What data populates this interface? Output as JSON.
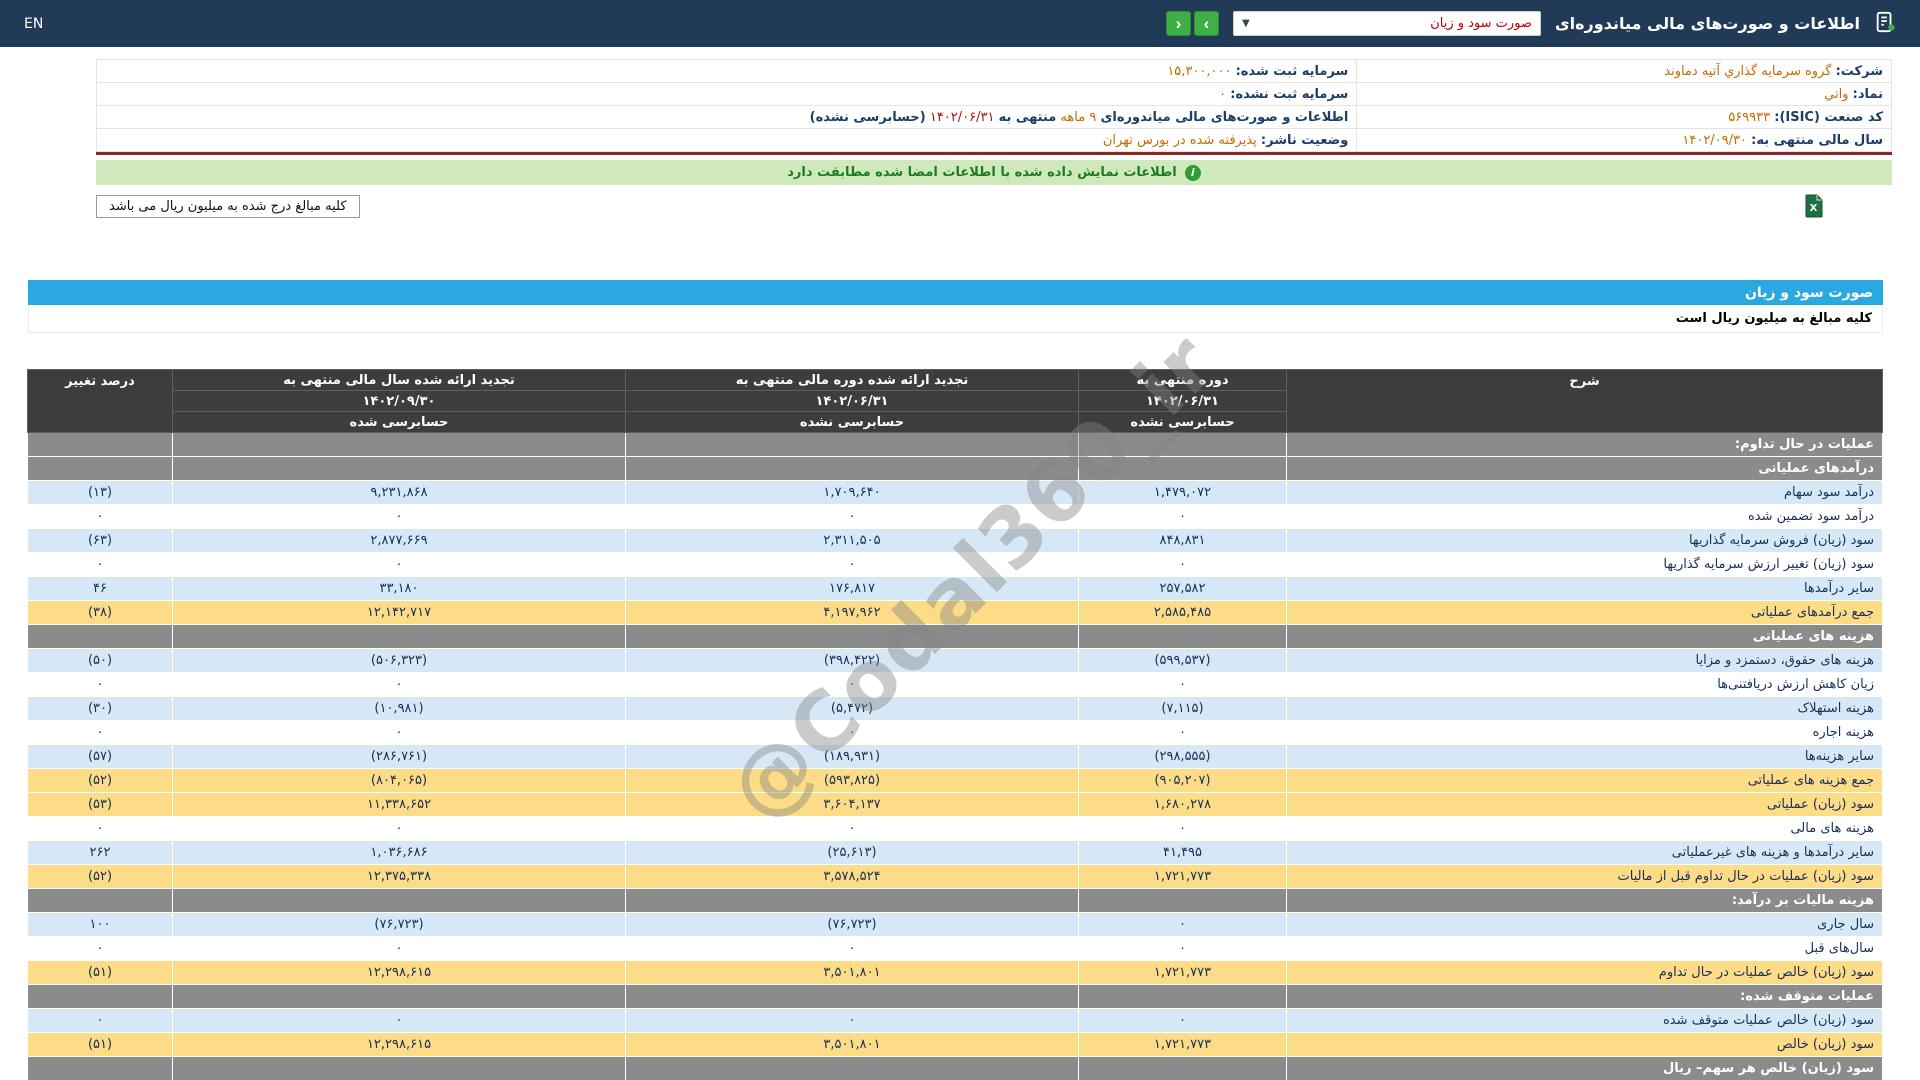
{
  "topbar": {
    "language": "EN",
    "title": "اطلاعات و صورت‌های مالی میاندوره‌ای",
    "report_dropdown": {
      "selected": "صورت سود و زیان",
      "caret": "▼"
    },
    "nav": {
      "right_arrow": "›",
      "left_arrow": "‹"
    }
  },
  "company_info": {
    "rows": [
      {
        "right_label": "شرکت:",
        "right_value": "گروه سرمایه گذاري آتیه دماوند",
        "left_label": "سرمایه ثبت شده:",
        "left_value": "۱۵,۳۰۰,۰۰۰"
      },
      {
        "right_label": "نماد:",
        "right_value": "واتي",
        "left_label": "سرمایه ثبت نشده:",
        "left_value": "۰"
      },
      {
        "right_label": "کد صنعت (ISIC):",
        "right_value": "۵۶۹۹۳۳",
        "left_prefix": "اطلاعات و صورت‌های مالی میاندوره‌ای",
        "left_period": "۹ ماهه",
        "left_middle": "منتهی به",
        "left_date": "۱۴۰۲/۰۶/۳۱",
        "left_suffix": "(حسابرسی نشده)"
      },
      {
        "right_label": "سال مالی منتهی به:",
        "right_value": "۱۴۰۲/۰۹/۳۰",
        "left_label": "وضعیت ناشر:",
        "left_value": "پذیرفته شده در بورس تهران"
      }
    ]
  },
  "banner": {
    "text": "اطلاعات نمایش داده شده با اطلاعات امضا شده مطابقت دارد",
    "icon": "i"
  },
  "note": {
    "text": "کلیه مبالغ درج شده به میلیون ریال می باشد"
  },
  "statement": {
    "title": "صورت سود و زیان",
    "subtitle": "کلیه مبالغ به میلیون ریال است"
  },
  "table": {
    "header": {
      "description": "شرح",
      "change": "درصد تغییر",
      "col1": {
        "title": "دوره منتهی به",
        "date": "۱۴۰۲/۰۶/۳۱",
        "audit": "حسابرسی نشده"
      },
      "col2": {
        "title": "تجدید ارائه شده دوره مالی منتهی به",
        "date": "۱۴۰۲/۰۶/۳۱",
        "audit": "حسابرسی نشده"
      },
      "col3": {
        "title": "تجدید ارائه شده سال مالی منتهی به",
        "date": "۱۴۰۲/۰۹/۳۰",
        "audit": "حسابرسی شده"
      }
    },
    "rows": [
      {
        "type": "section",
        "label": "عملیات در حال تداوم:"
      },
      {
        "type": "section",
        "label": "درآمدهای عملیاتی"
      },
      {
        "type": "data",
        "variant": "blue",
        "label": "درآمد سود سهام",
        "v1": "۱,۴۷۹,۰۷۲",
        "v2": "۱,۷۰۹,۶۴۰",
        "v3": "۹,۲۳۱,۸۶۸",
        "chg": "(۱۳)",
        "neg": [
          false,
          false,
          false,
          true
        ]
      },
      {
        "type": "data",
        "variant": "white",
        "label": "درآمد سود تضمین شده",
        "v1": "۰",
        "v2": "۰",
        "v3": "۰",
        "chg": "۰",
        "neg": [
          false,
          false,
          false,
          false
        ]
      },
      {
        "type": "data",
        "variant": "blue",
        "label": "سود (زیان) فروش سرمایه گذاریها",
        "v1": "۸۴۸,۸۳۱",
        "v2": "۲,۳۱۱,۵۰۵",
        "v3": "۲,۸۷۷,۶۶۹",
        "chg": "(۶۳)",
        "neg": [
          false,
          false,
          false,
          true
        ]
      },
      {
        "type": "data",
        "variant": "white",
        "label": "سود (زیان) تغییر ارزش سرمایه گذاریها",
        "v1": "۰",
        "v2": "۰",
        "v3": "۰",
        "chg": "۰",
        "neg": [
          false,
          false,
          false,
          false
        ]
      },
      {
        "type": "data",
        "variant": "blue",
        "label": "سایر درآمدها",
        "v1": "۲۵۷,۵۸۲",
        "v2": "۱۷۶,۸۱۷",
        "v3": "۳۳,۱۸۰",
        "chg": "۴۶",
        "neg": [
          false,
          false,
          false,
          false
        ]
      },
      {
        "type": "data",
        "variant": "yellow",
        "label": "جمع درآمدهای عملیاتی",
        "v1": "۲,۵۸۵,۴۸۵",
        "v2": "۴,۱۹۷,۹۶۲",
        "v3": "۱۲,۱۴۲,۷۱۷",
        "chg": "(۳۸)",
        "neg": [
          false,
          false,
          false,
          true
        ]
      },
      {
        "type": "section",
        "label": "هزینه های عملیاتی"
      },
      {
        "type": "data",
        "variant": "blue",
        "label": "هزینه های حقوق، دستمزد و مزایا",
        "v1": "(۵۹۹,۵۳۷)",
        "v2": "(۳۹۸,۴۲۲)",
        "v3": "(۵۰۶,۳۲۳)",
        "chg": "(۵۰)",
        "neg": [
          true,
          true,
          true,
          true
        ]
      },
      {
        "type": "data",
        "variant": "white",
        "label": "زیان کاهش ارزش دریافتنی‌ها",
        "v1": "۰",
        "v2": "۰",
        "v3": "۰",
        "chg": "۰",
        "neg": [
          false,
          false,
          false,
          false
        ]
      },
      {
        "type": "data",
        "variant": "blue",
        "label": "هزینه استهلاک",
        "v1": "(۷,۱۱۵)",
        "v2": "(۵,۴۷۲)",
        "v3": "(۱۰,۹۸۱)",
        "chg": "(۳۰)",
        "neg": [
          true,
          true,
          true,
          true
        ]
      },
      {
        "type": "data",
        "variant": "white",
        "label": "هزینه اجاره",
        "v1": "۰",
        "v2": "۰",
        "v3": "۰",
        "chg": "۰",
        "neg": [
          false,
          false,
          false,
          false
        ]
      },
      {
        "type": "data",
        "variant": "blue",
        "label": "سایر هزینه‌ها",
        "v1": "(۲۹۸,۵۵۵)",
        "v2": "(۱۸۹,۹۳۱)",
        "v3": "(۲۸۶,۷۶۱)",
        "chg": "(۵۷)",
        "neg": [
          true,
          true,
          true,
          true
        ]
      },
      {
        "type": "data",
        "variant": "yellow",
        "label": "جمع هزینه های عملیاتی",
        "v1": "(۹۰۵,۲۰۷)",
        "v2": "(۵۹۳,۸۲۵)",
        "v3": "(۸۰۴,۰۶۵)",
        "chg": "(۵۲)",
        "neg": [
          true,
          true,
          true,
          true
        ]
      },
      {
        "type": "data",
        "variant": "yellow",
        "label": "سود (زیان) عملیاتی",
        "v1": "۱,۶۸۰,۲۷۸",
        "v2": "۳,۶۰۴,۱۳۷",
        "v3": "۱۱,۳۳۸,۶۵۲",
        "chg": "(۵۳)",
        "neg": [
          false,
          false,
          false,
          true
        ]
      },
      {
        "type": "data",
        "variant": "white",
        "label": "هزینه های مالی",
        "v1": "۰",
        "v2": "۰",
        "v3": "۰",
        "chg": "۰",
        "neg": [
          false,
          false,
          false,
          false
        ]
      },
      {
        "type": "data",
        "variant": "blue",
        "label": "سایر درآمدها و هزینه های غیرعملیاتی",
        "v1": "۴۱,۴۹۵",
        "v2": "(۲۵,۶۱۳)",
        "v3": "۱,۰۳۶,۶۸۶",
        "chg": "۲۶۲",
        "neg": [
          false,
          true,
          false,
          false
        ]
      },
      {
        "type": "data",
        "variant": "yellow",
        "label": "سود (زیان) عملیات در حال تداوم قبل از مالیات",
        "v1": "۱,۷۲۱,۷۷۳",
        "v2": "۳,۵۷۸,۵۲۴",
        "v3": "۱۲,۳۷۵,۳۳۸",
        "chg": "(۵۲)",
        "neg": [
          false,
          false,
          false,
          true
        ]
      },
      {
        "type": "section",
        "label": "هزینه مالیات بر درآمد:"
      },
      {
        "type": "data",
        "variant": "blue",
        "label": "سال جاری",
        "v1": "۰",
        "v2": "(۷۶,۷۲۳)",
        "v3": "(۷۶,۷۲۳)",
        "chg": "۱۰۰",
        "neg": [
          false,
          true,
          true,
          false
        ]
      },
      {
        "type": "data",
        "variant": "white",
        "label": "سال‌های قبل",
        "v1": "۰",
        "v2": "۰",
        "v3": "۰",
        "chg": "۰",
        "neg": [
          false,
          false,
          false,
          false
        ]
      },
      {
        "type": "data",
        "variant": "yellow",
        "label": "سود (زیان) خالص عملیات در حال تداوم",
        "v1": "۱,۷۲۱,۷۷۳",
        "v2": "۳,۵۰۱,۸۰۱",
        "v3": "۱۲,۲۹۸,۶۱۵",
        "chg": "(۵۱)",
        "neg": [
          false,
          false,
          false,
          true
        ]
      },
      {
        "type": "section",
        "label": "عملیات متوقف شده:"
      },
      {
        "type": "data",
        "variant": "blue",
        "label": "سود (زیان) خالص عملیات متوقف شده",
        "v1": "۰",
        "v2": "۰",
        "v3": "۰",
        "chg": "۰",
        "neg": [
          false,
          false,
          false,
          false
        ]
      },
      {
        "type": "data",
        "variant": "yellow",
        "label": "سود (زیان) خالص",
        "v1": "۱,۷۲۱,۷۷۳",
        "v2": "۳,۵۰۱,۸۰۱",
        "v3": "۱۲,۲۹۸,۶۱۵",
        "chg": "(۵۱)",
        "neg": [
          false,
          false,
          false,
          true
        ]
      },
      {
        "type": "section",
        "label": "سود (زیان) خالص هر سهم– ریال"
      }
    ]
  },
  "watermark": {
    "text": "@Codal360_ir"
  },
  "colors": {
    "topbar_bg": "#213a57",
    "accent_blue": "#2aa9e0",
    "highlight_yellow": "#fcdc86",
    "row_blue": "#d6e8f6",
    "section_gray": "#8b8b8b",
    "header_dark": "#3d3d3d",
    "negative_red": "#d40000",
    "value_orange": "#c66a00",
    "nav_green": "#3fae46",
    "banner_green_bg": "#cfe9bd",
    "divider_maroon": "#8d2525"
  }
}
